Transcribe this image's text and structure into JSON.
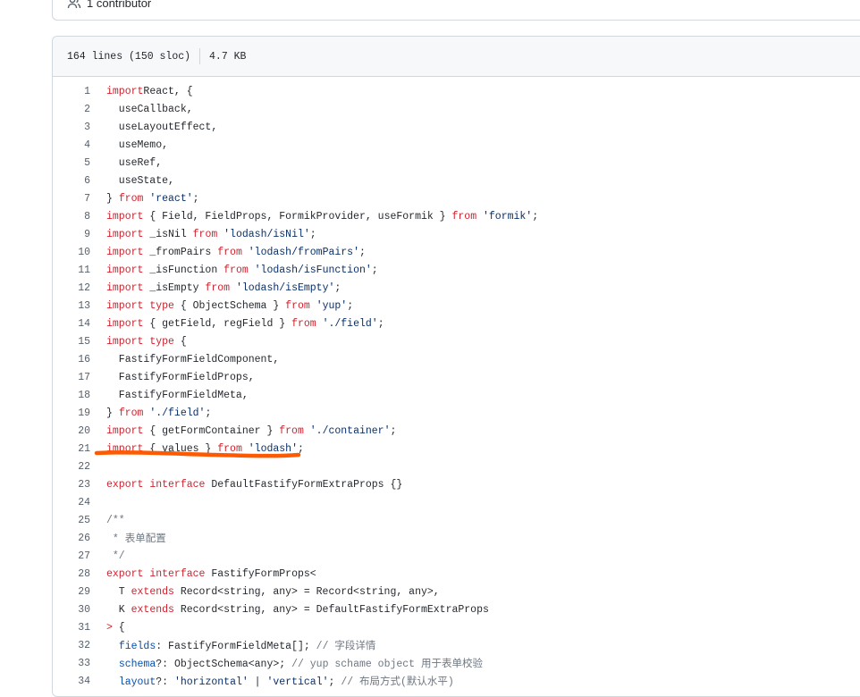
{
  "contributors": {
    "label": "1 contributor",
    "icon": "people-icon"
  },
  "file_info": {
    "lines": "164 lines (150 sloc)",
    "size": "4.7 KB"
  },
  "code_lines": [
    {
      "n": "1",
      "t": [
        [
          "kw",
          "import"
        ],
        [
          "",
          "React, {"
        ]
      ]
    },
    {
      "n": "2",
      "t": [
        [
          "",
          "  useCallback,"
        ]
      ]
    },
    {
      "n": "3",
      "t": [
        [
          "",
          "  useLayoutEffect,"
        ]
      ]
    },
    {
      "n": "4",
      "t": [
        [
          "",
          "  useMemo,"
        ]
      ]
    },
    {
      "n": "5",
      "t": [
        [
          "",
          "  useRef,"
        ]
      ]
    },
    {
      "n": "6",
      "t": [
        [
          "",
          "  useState,"
        ]
      ]
    },
    {
      "n": "7",
      "t": [
        [
          "",
          "} "
        ],
        [
          "kw",
          "from"
        ],
        [
          "",
          " "
        ],
        [
          "str",
          "'react'"
        ],
        [
          "",
          ";"
        ]
      ]
    },
    {
      "n": "8",
      "t": [
        [
          "kw",
          "import"
        ],
        [
          "",
          " { Field, FieldProps, FormikProvider, useFormik } "
        ],
        [
          "kw",
          "from"
        ],
        [
          "",
          " "
        ],
        [
          "str",
          "'formik'"
        ],
        [
          "",
          ";"
        ]
      ]
    },
    {
      "n": "9",
      "t": [
        [
          "kw",
          "import"
        ],
        [
          "",
          " _isNil "
        ],
        [
          "kw",
          "from"
        ],
        [
          "",
          " "
        ],
        [
          "str",
          "'lodash/isNil'"
        ],
        [
          "",
          ";"
        ]
      ]
    },
    {
      "n": "10",
      "t": [
        [
          "kw",
          "import"
        ],
        [
          "",
          " _fromPairs "
        ],
        [
          "kw",
          "from"
        ],
        [
          "",
          " "
        ],
        [
          "str",
          "'lodash/fromPairs'"
        ],
        [
          "",
          ";"
        ]
      ]
    },
    {
      "n": "11",
      "t": [
        [
          "kw",
          "import"
        ],
        [
          "",
          " _isFunction "
        ],
        [
          "kw",
          "from"
        ],
        [
          "",
          " "
        ],
        [
          "str",
          "'lodash/isFunction'"
        ],
        [
          "",
          ";"
        ]
      ]
    },
    {
      "n": "12",
      "t": [
        [
          "kw",
          "import"
        ],
        [
          "",
          " _isEmpty "
        ],
        [
          "kw",
          "from"
        ],
        [
          "",
          " "
        ],
        [
          "str",
          "'lodash/isEmpty'"
        ],
        [
          "",
          ";"
        ]
      ]
    },
    {
      "n": "13",
      "t": [
        [
          "kw",
          "import"
        ],
        [
          "",
          " "
        ],
        [
          "kw",
          "type"
        ],
        [
          "",
          " { ObjectSchema } "
        ],
        [
          "kw",
          "from"
        ],
        [
          "",
          " "
        ],
        [
          "str",
          "'yup'"
        ],
        [
          "",
          ";"
        ]
      ]
    },
    {
      "n": "14",
      "t": [
        [
          "kw",
          "import"
        ],
        [
          "",
          " { getField, regField } "
        ],
        [
          "kw",
          "from"
        ],
        [
          "",
          " "
        ],
        [
          "str",
          "'./field'"
        ],
        [
          "",
          ";"
        ]
      ]
    },
    {
      "n": "15",
      "t": [
        [
          "kw",
          "import"
        ],
        [
          "",
          " "
        ],
        [
          "kw",
          "type"
        ],
        [
          "",
          " {"
        ]
      ]
    },
    {
      "n": "16",
      "t": [
        [
          "",
          "  FastifyFormFieldComponent,"
        ]
      ]
    },
    {
      "n": "17",
      "t": [
        [
          "",
          "  FastifyFormFieldProps,"
        ]
      ]
    },
    {
      "n": "18",
      "t": [
        [
          "",
          "  FastifyFormFieldMeta,"
        ]
      ]
    },
    {
      "n": "19",
      "t": [
        [
          "",
          "} "
        ],
        [
          "kw",
          "from"
        ],
        [
          "",
          " "
        ],
        [
          "str",
          "'./field'"
        ],
        [
          "",
          ";"
        ]
      ]
    },
    {
      "n": "20",
      "t": [
        [
          "kw",
          "import"
        ],
        [
          "",
          " { getFormContainer } "
        ],
        [
          "kw",
          "from"
        ],
        [
          "",
          " "
        ],
        [
          "str",
          "'./container'"
        ],
        [
          "",
          ";"
        ]
      ]
    },
    {
      "n": "21",
      "t": [
        [
          "kw",
          "import"
        ],
        [
          "",
          " { values } "
        ],
        [
          "kw",
          "from"
        ],
        [
          "",
          " "
        ],
        [
          "str",
          "'lodash'"
        ],
        [
          "",
          ";"
        ]
      ]
    },
    {
      "n": "22",
      "t": []
    },
    {
      "n": "23",
      "t": [
        [
          "kw",
          "export"
        ],
        [
          "",
          " "
        ],
        [
          "kw",
          "interface"
        ],
        [
          "",
          " DefaultFastifyFormExtraProps {}"
        ]
      ]
    },
    {
      "n": "24",
      "t": []
    },
    {
      "n": "25",
      "t": [
        [
          "cm",
          "/**"
        ]
      ]
    },
    {
      "n": "26",
      "t": [
        [
          "cm",
          " * 表单配置"
        ]
      ]
    },
    {
      "n": "27",
      "t": [
        [
          "cm",
          " */"
        ]
      ]
    },
    {
      "n": "28",
      "t": [
        [
          "kw",
          "export"
        ],
        [
          "",
          " "
        ],
        [
          "kw",
          "interface"
        ],
        [
          "",
          " FastifyFormProps<"
        ]
      ]
    },
    {
      "n": "29",
      "t": [
        [
          "",
          "  T "
        ],
        [
          "kw",
          "extends"
        ],
        [
          "",
          " Record<string, any> = Record<string, any>,"
        ]
      ]
    },
    {
      "n": "30",
      "t": [
        [
          "",
          "  K "
        ],
        [
          "kw",
          "extends"
        ],
        [
          "",
          " Record<string, any> = DefaultFastifyFormExtraProps"
        ]
      ]
    },
    {
      "n": "31",
      "t": [
        [
          "kw",
          ">"
        ],
        [
          "",
          " {"
        ]
      ]
    },
    {
      "n": "32",
      "t": [
        [
          "",
          "  "
        ],
        [
          "pr",
          "fields"
        ],
        [
          "",
          ": FastifyFormFieldMeta[]; "
        ],
        [
          "cm",
          "// 字段详情"
        ]
      ]
    },
    {
      "n": "33",
      "t": [
        [
          "",
          "  "
        ],
        [
          "pr",
          "schema"
        ],
        [
          "",
          "?: ObjectSchema<any>; "
        ],
        [
          "cm",
          "// yup schame object 用于表单校验"
        ]
      ]
    },
    {
      "n": "34",
      "t": [
        [
          "",
          "  "
        ],
        [
          "pr",
          "layout"
        ],
        [
          "",
          "?: "
        ],
        [
          "str",
          "'horizontal'"
        ],
        [
          "",
          " | "
        ],
        [
          "str",
          "'vertical'"
        ],
        [
          "",
          "; "
        ],
        [
          "cm",
          "// 布局方式(默认水平)"
        ]
      ]
    }
  ]
}
